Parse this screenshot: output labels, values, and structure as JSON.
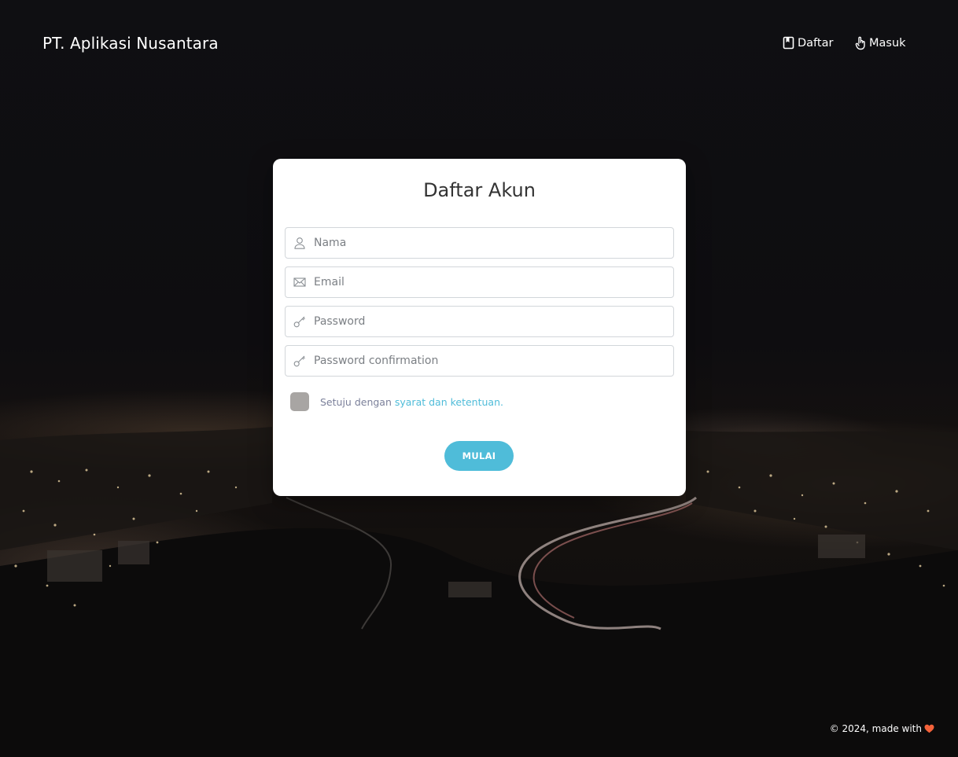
{
  "navbar": {
    "brand": "PT. Aplikasi Nusantara",
    "links": [
      {
        "label": "Daftar",
        "icon": "book-icon"
      },
      {
        "label": "Masuk",
        "icon": "hand-pointer-icon"
      }
    ]
  },
  "form": {
    "title": "Daftar Akun",
    "fields": [
      {
        "placeholder": "Nama",
        "icon": "user-icon"
      },
      {
        "placeholder": "Email",
        "icon": "envelope-icon"
      },
      {
        "placeholder": "Password",
        "icon": "key-icon"
      },
      {
        "placeholder": "Password confirmation",
        "icon": "key-icon"
      }
    ],
    "agree_text": "Setuju dengan ",
    "terms_link": "syarat dan ketentuan.",
    "submit_label": "MULAI"
  },
  "footer": {
    "text": "© 2024, made with",
    "icon": "heart-icon"
  },
  "colors": {
    "accent": "#4fbcd9",
    "heart": "#f4623a",
    "checkbox": "#a8a5a3"
  }
}
